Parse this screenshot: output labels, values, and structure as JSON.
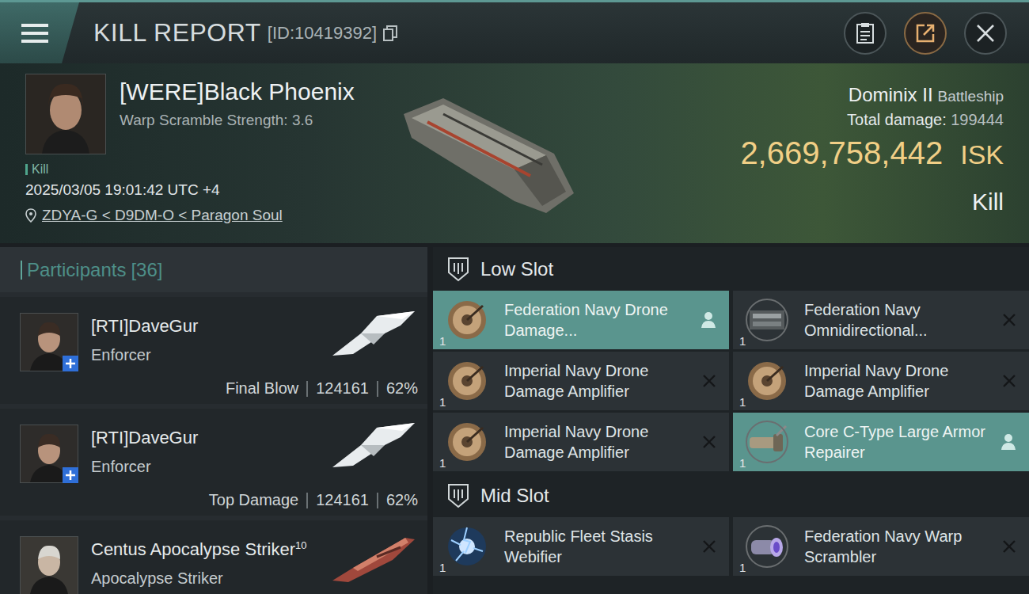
{
  "header": {
    "title": "KILL REPORT",
    "report_id": "[ID:10419392]"
  },
  "victim": {
    "name": "[WERE]Black Phoenix",
    "warp_scramble": "Warp Scramble Strength: 3.6",
    "tag": "Kill",
    "datetime": "2025/03/05 19:01:42 UTC +4",
    "location": "ZDYA-G < D9DM-O < Paragon Soul"
  },
  "ship": {
    "name": "Dominix II",
    "class": "Battleship",
    "damage_label": "Total damage:",
    "damage": "199444",
    "value": "2,669,758,442",
    "currency": "ISK",
    "result": "Kill"
  },
  "participants": {
    "label": "Participants",
    "count": "[36]",
    "rows": [
      {
        "name": "[RTI]DaveGur",
        "superscript": "",
        "ship": "Enforcer",
        "kind": "enforcer",
        "plus_badge": true,
        "role": "Final Blow",
        "damage": "124161",
        "share": "62%"
      },
      {
        "name": "[RTI]DaveGur",
        "superscript": "",
        "ship": "Enforcer",
        "kind": "enforcer",
        "plus_badge": true,
        "role": "Top Damage",
        "damage": "124161",
        "share": "62%"
      },
      {
        "name": "Centus Apocalypse Striker",
        "superscript": "10",
        "ship": "Apocalypse Striker",
        "kind": "striker",
        "plus_badge": false,
        "role": "",
        "damage": "",
        "share": ""
      }
    ]
  },
  "slots": [
    {
      "title": "Low Slot",
      "items": [
        {
          "qty": "1",
          "name": "Federation Navy Drone Damage...",
          "kind": "amplifier",
          "dropped": true
        },
        {
          "qty": "1",
          "name": "Federation Navy Omnidirectional...",
          "kind": "omni",
          "dropped": false
        },
        {
          "qty": "1",
          "name": "Imperial Navy Drone Damage Amplifier",
          "kind": "amplifier",
          "dropped": false
        },
        {
          "qty": "1",
          "name": "Imperial Navy Drone Damage Amplifier",
          "kind": "amplifier",
          "dropped": false
        },
        {
          "qty": "1",
          "name": "Imperial Navy Drone Damage Amplifier",
          "kind": "amplifier",
          "dropped": false
        },
        {
          "qty": "1",
          "name": "Core C-Type Large Armor Repairer",
          "kind": "repairer",
          "dropped": true
        }
      ]
    },
    {
      "title": "Mid Slot",
      "items": [
        {
          "qty": "1",
          "name": "Republic Fleet Stasis Webifier",
          "kind": "webifier",
          "dropped": false
        },
        {
          "qty": "1",
          "name": "Federation Navy Warp Scrambler",
          "kind": "scrambler",
          "dropped": false
        }
      ]
    }
  ]
}
